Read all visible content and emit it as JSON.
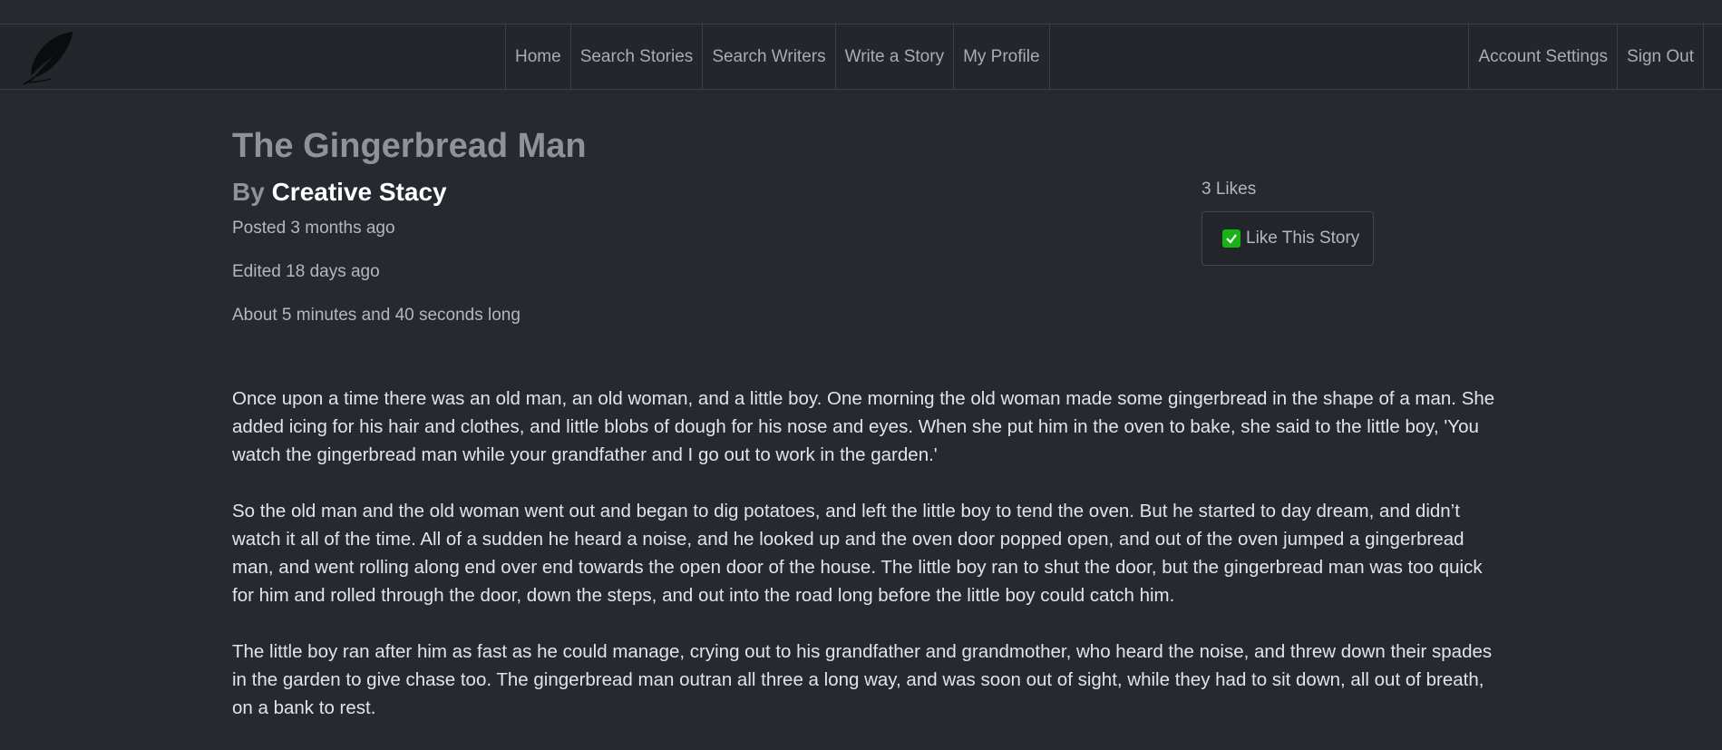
{
  "nav": {
    "center": [
      "Home",
      "Search Stories",
      "Search Writers",
      "Write a Story",
      "My Profile"
    ],
    "right": [
      "Account Settings",
      "Sign Out"
    ]
  },
  "story": {
    "title": "The Gingerbread Man",
    "by_prefix": "By",
    "author": "Creative Stacy",
    "posted": "Posted 3 months ago",
    "edited": "Edited 18 days ago",
    "length": "About 5 minutes and 40 seconds long",
    "likes": "3 Likes",
    "like_button": "Like This Story",
    "paragraphs": [
      "Once upon a time there was an old man, an old woman, and a little boy. One morning the old woman made some gingerbread in the shape of a man. She added icing for his hair and clothes, and little blobs of dough for his nose and eyes. When she put him in the oven to bake, she said to the little boy, 'You watch the gingerbread man while your grandfather and I go out to work in the garden.'",
      "So the old man and the old woman went out and began to dig potatoes, and left the little boy to tend the oven. But he started to day dream, and didn’t watch it all of the time. All of a sudden he heard a noise, and he looked up and the oven door popped open, and out of the oven jumped a gingerbread man, and went rolling along end over end towards the open door of the house. The little boy ran to shut the door, but the gingerbread man was too quick for him and rolled through the door, down the steps, and out into the road long before the little boy could catch him.",
      "The little boy ran after him as fast as he could manage, crying out to his grandfather and grandmother, who heard the noise, and threw down their spades in the garden to give chase too. The gingerbread man outran all three a long way, and was soon out of sight, while they had to sit down, all out of breath, on a bank to rest."
    ]
  },
  "colors": {
    "background": "#262a30",
    "navbar": "#23272c",
    "like_check": "#17b317"
  },
  "icons": [
    "quill-feather-icon",
    "checkbox-checked-icon"
  ]
}
